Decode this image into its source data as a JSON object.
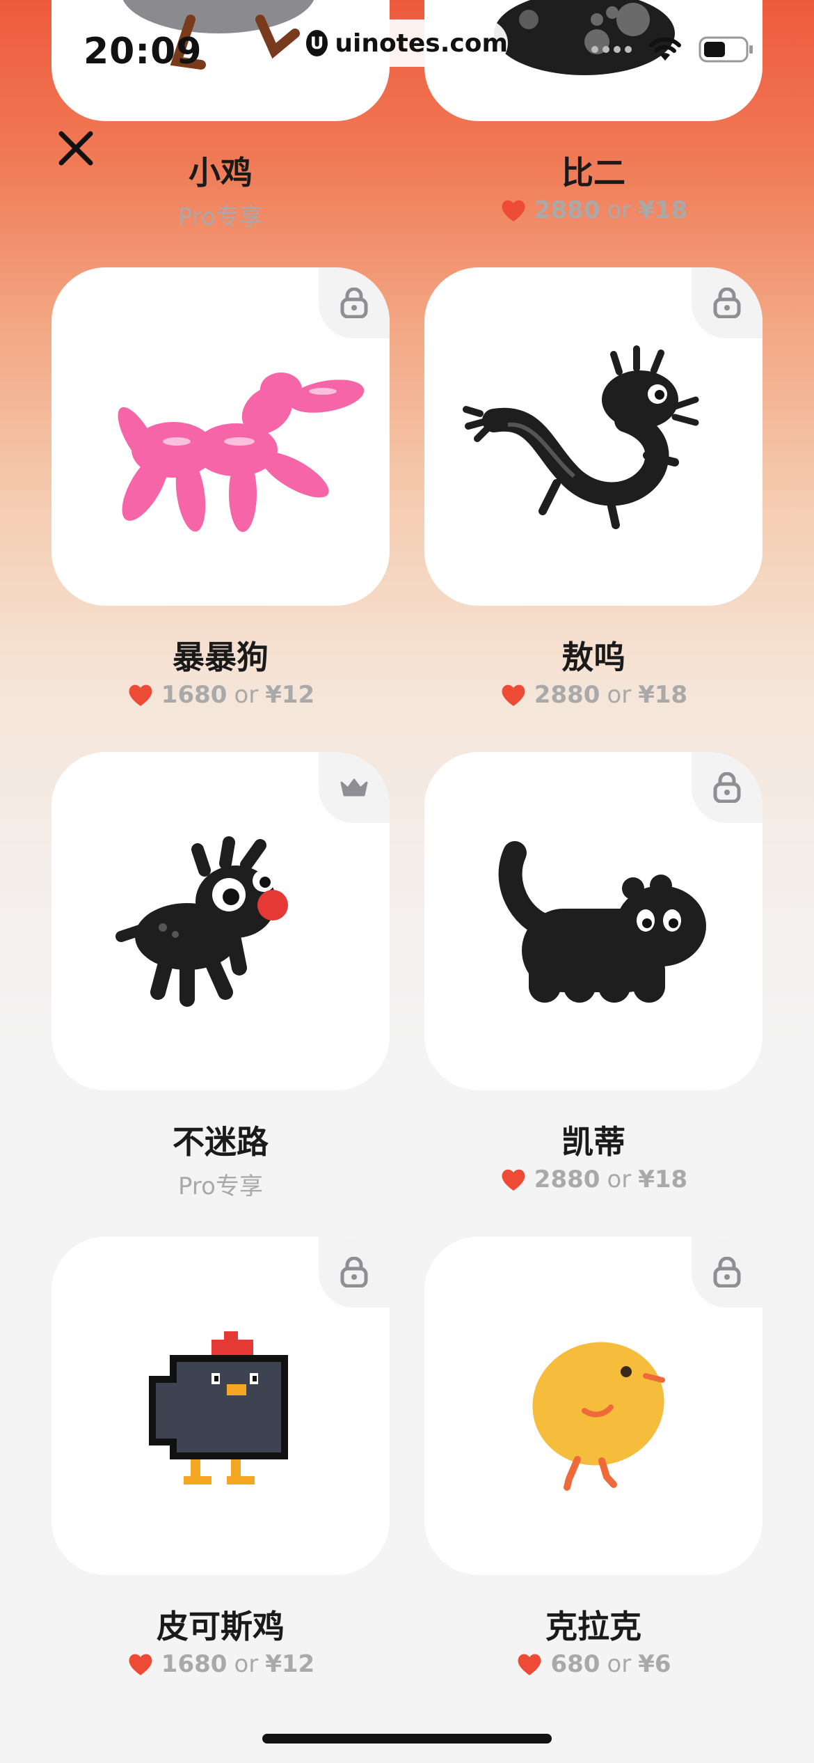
{
  "status": {
    "time": "20:09",
    "watermark": "uinotes.com"
  },
  "items": [
    {
      "name": "小鸡",
      "pro": "Pro专享"
    },
    {
      "name": "比二",
      "coins": "2880",
      "or": "or",
      "cash": "¥18"
    },
    {
      "name": "暴暴狗",
      "coins": "1680",
      "or": "or",
      "cash": "¥12",
      "corner_icon": "lock-icon"
    },
    {
      "name": "敖呜",
      "coins": "2880",
      "or": "or",
      "cash": "¥18",
      "corner_icon": "lock-icon"
    },
    {
      "name": "不迷路",
      "pro": "Pro专享",
      "corner_icon": "crown-icon"
    },
    {
      "name": "凯蒂",
      "coins": "2880",
      "or": "or",
      "cash": "¥18",
      "corner_icon": "lock-icon"
    },
    {
      "name": "皮可斯鸡",
      "coins": "1680",
      "or": "or",
      "cash": "¥12",
      "corner_icon": "lock-icon"
    },
    {
      "name": "克拉克",
      "coins": "680",
      "or": "or",
      "cash": "¥6",
      "corner_icon": "lock-icon"
    }
  ],
  "colors": {
    "accent": "#ee4b36",
    "card": "#ffffff",
    "muted": "#a9a9a9"
  }
}
